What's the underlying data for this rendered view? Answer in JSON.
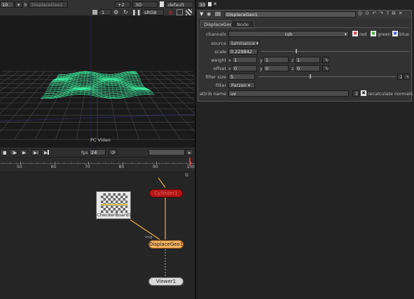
{
  "viewer": {
    "frame_field": "10",
    "b_label": "B",
    "input_node": "DisplaceGeo1",
    "gain": "+2",
    "mode": "3D",
    "camera": "default",
    "channel_num": "1",
    "colorspace": "sRGB",
    "format_label": "PC Video"
  },
  "timeline": {
    "fps_label": "fps",
    "fps_value": "24",
    "ticks": [
      "50",
      "60",
      "70",
      "80",
      "90",
      "100"
    ]
  },
  "properties": {
    "max_panels": "10",
    "clear_label": "✕",
    "node_name": "DisplaceGeo1",
    "tabs": [
      "DisplaceGeo",
      "Node"
    ],
    "channels": {
      "label": "channels",
      "value": "rgb",
      "checks": [
        "red",
        "green",
        "blue"
      ]
    },
    "source": {
      "label": "source",
      "value": "luminance"
    },
    "scale": {
      "label": "scale",
      "value": "0.229842",
      "slider": 0.23
    },
    "weight": {
      "label": "weight",
      "x": "1",
      "y": "1",
      "z": "1"
    },
    "offset": {
      "label": "offset",
      "x": "0",
      "y": "0",
      "z": "0"
    },
    "filter_size": {
      "label": "filter size",
      "value": "5",
      "slider": 0.37
    },
    "filter": {
      "label": "filter",
      "value": "Parzen"
    },
    "attrib_name": {
      "label": "attrib name",
      "value": "uv"
    },
    "recalc": {
      "label": "recalculate normals",
      "num": "2"
    },
    "axis_x": "x",
    "axis_y": "y",
    "axis_z": "z"
  },
  "nodegraph": {
    "nodes": {
      "checker": "CheckerBoard1",
      "red_node": "Cylinder1",
      "displace": "DisplaceGeo1",
      "viewer": "Viewer1"
    },
    "input_tag": "img"
  },
  "colors": {
    "wave": "#3cf0a0",
    "grid": "#4a4a4a",
    "node_red": "#b01818",
    "node_orange": "#f0b060",
    "link": "#e8b048"
  }
}
